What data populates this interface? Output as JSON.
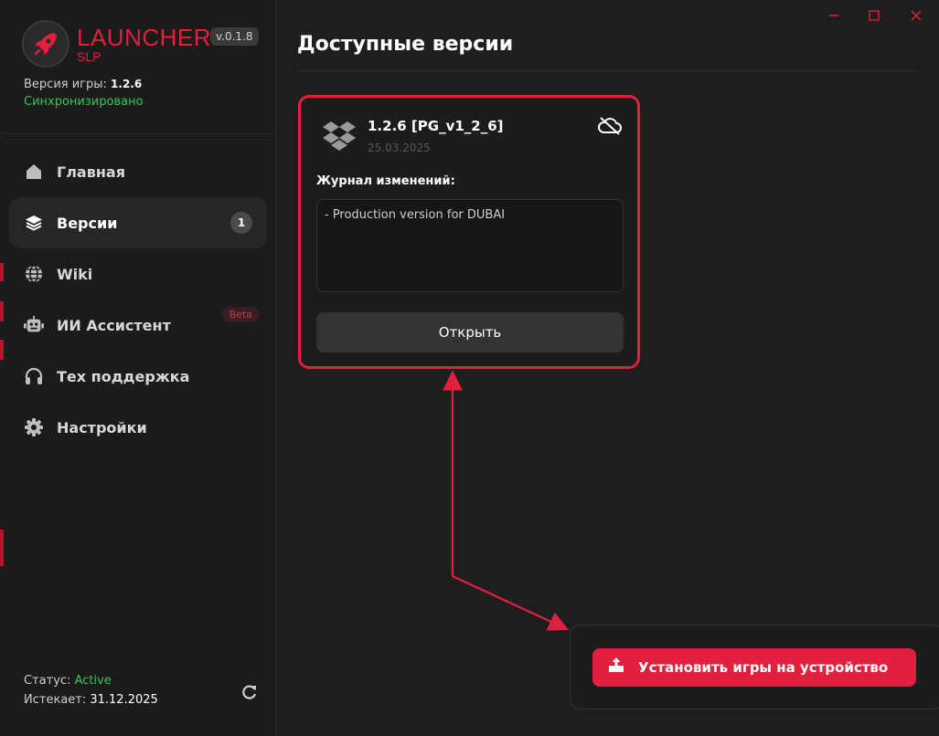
{
  "brand": {
    "title": "LAUNCHER",
    "subtitle": "SLP",
    "version": "v.0.1.8"
  },
  "game": {
    "version_label": "Версия игры:",
    "version_value": "1.2.6",
    "sync_status": "Синхронизировано"
  },
  "nav": {
    "items": [
      {
        "label": "Главная",
        "icon": "home-icon"
      },
      {
        "label": "Версии",
        "icon": "layers-icon",
        "badge": "1",
        "active": true
      },
      {
        "label": "Wiki",
        "icon": "globe-icon"
      },
      {
        "label": "ИИ Ассистент",
        "icon": "robot-icon",
        "tag": "Beta"
      },
      {
        "label": "Тех поддержка",
        "icon": "headphones-icon"
      },
      {
        "label": "Настройки",
        "icon": "gear-icon"
      }
    ]
  },
  "footer": {
    "status_label": "Статус:",
    "status_value": "Active",
    "expires_label": "Истекает:",
    "expires_value": "31.12.2025"
  },
  "main": {
    "title": "Доступные версии",
    "card": {
      "name": "1.2.6 [PG_v1_2_6]",
      "date": "25.03.2025",
      "changelog_title": "Журнал изменений:",
      "changelog_text": "- Production version for DUBAI",
      "open_label": "Открыть"
    },
    "install_label": "Установить игры на устройство"
  },
  "colors": {
    "accent": "#e21f3d",
    "success": "#34c759",
    "background": "#1e1e1e"
  }
}
